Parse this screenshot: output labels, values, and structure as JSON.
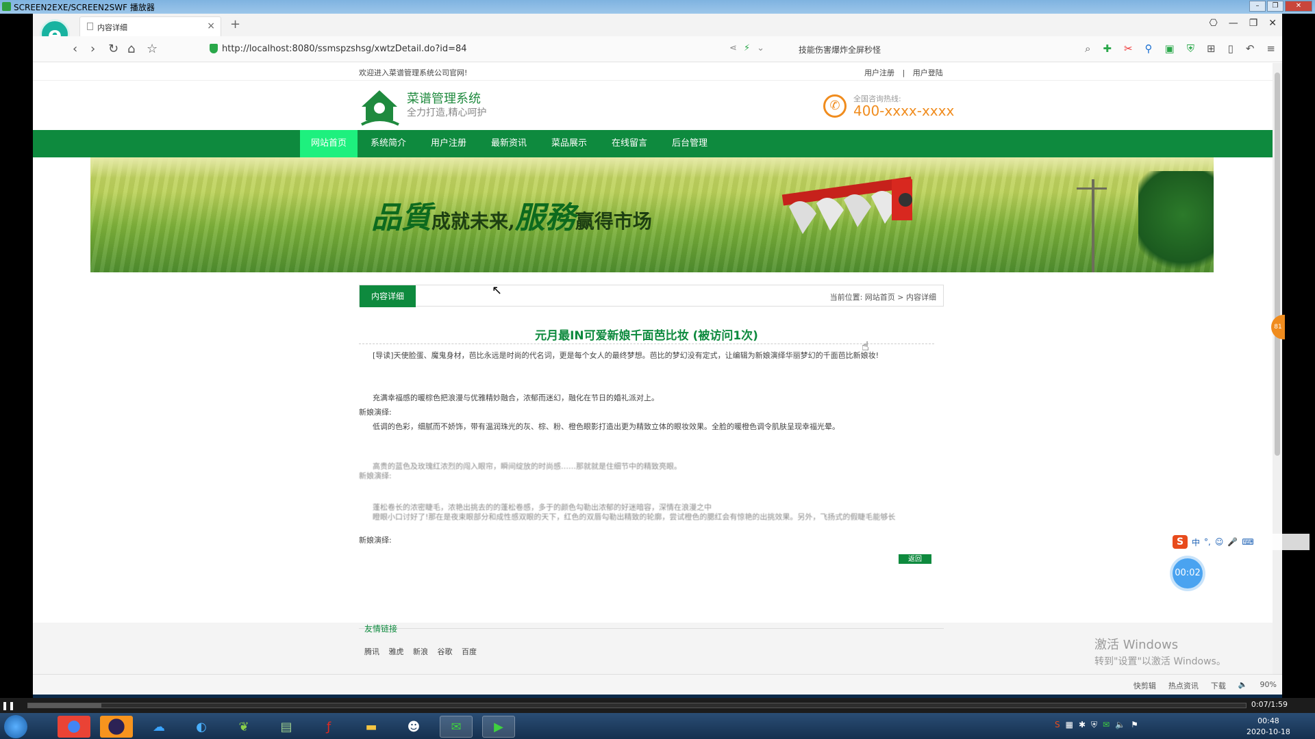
{
  "player": {
    "title": "SCREEN2EXE/SCREEN2SWF 播放器",
    "progress": 0.06,
    "time": "0:07/1:59"
  },
  "browser": {
    "tab_title": "内容详细",
    "url": "http://localhost:8080/ssmspzshsg/xwtzDetail.do?id=84",
    "hot_search": "技能伤害爆炸全屏秒怪",
    "status": {
      "fast_edit": "快剪辑",
      "hot_news": "热点资讯",
      "download": "下载",
      "zoom": "90%"
    }
  },
  "site": {
    "welcome": "欢迎进入菜谱管理系统公司官网!",
    "register": "用户注册",
    "login": "用户登陆",
    "separator": "|",
    "logo_title": "菜谱管理系统",
    "logo_sub": "全力打造,精心呵护",
    "hotline_label": "全国咨询热线:",
    "hotline_number": "400-xxxx-xxxx",
    "nav": [
      "网站首页",
      "系统简介",
      "用户注册",
      "最新资讯",
      "菜品展示",
      "在线留言",
      "后台管理"
    ],
    "banner": {
      "q1": "品質",
      "t1": "成就未来,",
      "q2": "服務",
      "t2": "赢得市场"
    }
  },
  "article": {
    "tab": "内容详细",
    "breadcrumb": "当前位置: 网站首页 > 内容详细",
    "title": "元月最IN可爱新娘千面芭比妆 (被访问1次)",
    "intro": "[导读]天使脸蛋、魔鬼身材，芭比永远是时尚的代名词，更是每个女人的最终梦想。芭比的梦幻没有定式，让编辑为新娘演绎华丽梦幻的千面芭比新娘妆!",
    "p1": "充满幸福感的暖棕色把浪漫与优雅精妙融合，浓郁而迷幻，融化在节日的婚礼派对上。",
    "label1": "新娘演绎:",
    "p2": "低调的色彩，细腻而不娇饰，带有温润珠光的灰、棕、粉、橙色眼影打造出更为精致立体的眼妆效果。全脸的暖橙色调令肌肤呈现幸福光晕。",
    "p3": "高贵的蓝色及玫瑰红浓烈的闯入眼帘，瞬间绽放的时尚感……那就就是住细节中的精致亮眼。",
    "label2": "新娘演绎:",
    "p4": "蓬松卷长的浓密睫毛，浓艳出挑去的的蓬松卷感，多于的颜色勾勒出浓郁的好迷暗容，深情在浪漫之中",
    "p5": "瞪眼小口讨好了!那在是夜束眼部分和成性感双眼的天下，红色的双唇勾勒出精致的轮廓，尝试橙色的腮红会有惊艳的出挑效果。另外，飞扬式的假睫毛能够长",
    "label3": "新娘演绎:",
    "back": "返回"
  },
  "footer": {
    "links_title": "友情链接",
    "links": [
      "腾讯",
      "雅虎",
      "新浪",
      "谷歌",
      "百度"
    ],
    "activate1": "激活 Windows",
    "activate2": "转到\"设置\"以激活 Windows。"
  },
  "overlay": {
    "ime": [
      "中",
      "°,",
      "☺",
      "🎤",
      "⌨"
    ],
    "timer": "00:02",
    "side": "81"
  },
  "taskbar": {
    "clock_time": "00:48",
    "clock_date": "2020-10-18"
  }
}
